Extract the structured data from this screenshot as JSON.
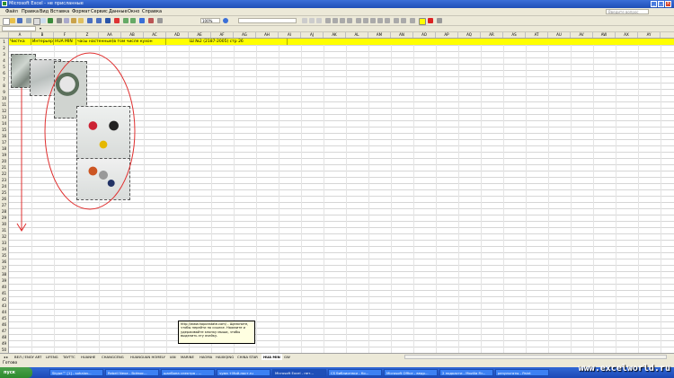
{
  "window": {
    "title": "Microsoft Excel - не присланные"
  },
  "menu": {
    "items": [
      "Файл",
      "Правка",
      "Вид",
      "Вставка",
      "Формат",
      "Сервис",
      "Данные",
      "Окно",
      "Справка"
    ],
    "help_placeholder": "Введите вопрос"
  },
  "toolbar": {
    "zoom": "100%"
  },
  "columns": [
    "A",
    "B",
    "F",
    "Z",
    "AA",
    "AB",
    "AC",
    "AD",
    "AE",
    "AF",
    "AG",
    "AH",
    "AI",
    "AJ",
    "AK",
    "AL",
    "AM",
    "AN",
    "AO",
    "AP",
    "AQ",
    "AR",
    "AS",
    "AT",
    "AU",
    "AV",
    "AW",
    "AX",
    "AY"
  ],
  "rows": [
    "1",
    "2",
    "3",
    "4",
    "5",
    "6",
    "7",
    "8",
    "9",
    "10",
    "11",
    "12",
    "13",
    "14",
    "15",
    "16",
    "17",
    "18",
    "19",
    "20",
    "21",
    "22",
    "23",
    "24",
    "25",
    "26",
    "27",
    "28",
    "29",
    "30",
    "31",
    "32",
    "33",
    "34",
    "35",
    "36",
    "37",
    "38",
    "39",
    "40",
    "41",
    "42",
    "43",
    "44",
    "45",
    "46",
    "47",
    "48",
    "49",
    "50"
  ],
  "row1": {
    "a": "Чистка",
    "b": "Интерьер",
    "f": "HUA MIN",
    "z": "часы настенные(в том числе кухон",
    "ae": "Ш №2 (2187-2005) стр 26"
  },
  "comment": {
    "line1": "http://www.hoponstate.com/ - Щелкните,",
    "line2": "чтобы перейти по ссылке. Нажмите и",
    "line3": "удерживайте кнопку мыши, чтобы",
    "line4": "выделить эту ячейку."
  },
  "tabs": [
    "ВЕЛ / ENGY ART",
    "LIFENG",
    "TAYTTC",
    "HUANHE",
    "CHANGCENG",
    "HUANGUAN HOMELY",
    "IAN",
    "MARINE",
    "HAOMA",
    "HAIXIQING",
    "CHINA STAR",
    "HUA MIN",
    "GW"
  ],
  "active_tab": "HUA MIN",
  "status": {
    "text": "Готово"
  },
  "taskbar": {
    "start": "пуск",
    "tasks": [
      "Skype™ [1] - sohalov...",
      "Rebell Nexa - Всёвос...",
      "шалбона спектра - ...",
      "чума +Мой-пост.ru",
      "Microsoft Excel - нет...",
      "CS библиотеки - Ко...",
      "Microsoft Office - ведр...",
      "2 подкасти - Mozilla Fir...",
      "результаты - Paint"
    ],
    "watermark": "www.excelworld.ru"
  }
}
